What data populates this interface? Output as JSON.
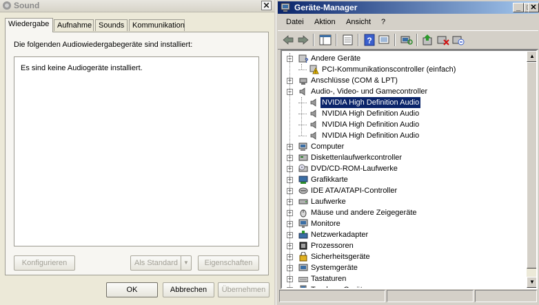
{
  "sound": {
    "title": "Sound",
    "tabs": [
      "Wiedergabe",
      "Aufnahme",
      "Sounds",
      "Kommunikation"
    ],
    "description": "Die folgenden Audiowiedergabegeräte sind installiert:",
    "empty_message": "Es sind keine Audiogeräte installiert.",
    "buttons": {
      "configure": "Konfigurieren",
      "set_default": "Als Standard",
      "properties": "Eigenschaften",
      "ok": "OK",
      "cancel": "Abbrechen",
      "apply": "Übernehmen"
    }
  },
  "devmgr": {
    "title": "Geräte-Manager",
    "menu": [
      "Datei",
      "Aktion",
      "Ansicht",
      "?"
    ],
    "toolbar_icons": [
      "back-arrow-icon",
      "forward-arrow-icon",
      "console-tree-icon",
      "properties-icon",
      "help-icon",
      "show-hidden-icon",
      "scan-hardware-icon",
      "update-driver-icon",
      "uninstall-icon",
      "disable-icon"
    ],
    "tree": [
      {
        "label": "Andere Geräte",
        "level": 1,
        "expander": "minus",
        "icon": "unknown-device-icon"
      },
      {
        "label": "PCI-Kommunikationscontroller (einfach)",
        "level": 2,
        "expander": "",
        "icon": "warning-device-icon"
      },
      {
        "label": "Anschlüsse (COM & LPT)",
        "level": 1,
        "expander": "plus",
        "icon": "port-icon"
      },
      {
        "label": "Audio-, Video- und Gamecontroller",
        "level": 1,
        "expander": "minus",
        "icon": "speaker-icon"
      },
      {
        "label": "NVIDIA High Definition Audio",
        "level": 2,
        "expander": "",
        "icon": "speaker-icon",
        "selected": true
      },
      {
        "label": "NVIDIA High Definition Audio",
        "level": 2,
        "expander": "",
        "icon": "speaker-icon"
      },
      {
        "label": "NVIDIA High Definition Audio",
        "level": 2,
        "expander": "",
        "icon": "speaker-icon"
      },
      {
        "label": "NVIDIA High Definition Audio",
        "level": 2,
        "expander": "",
        "icon": "speaker-icon"
      },
      {
        "label": "Computer",
        "level": 1,
        "expander": "plus",
        "icon": "computer-icon"
      },
      {
        "label": "Diskettenlaufwerkcontroller",
        "level": 1,
        "expander": "plus",
        "icon": "floppy-controller-icon"
      },
      {
        "label": "DVD/CD-ROM-Laufwerke",
        "level": 1,
        "expander": "plus",
        "icon": "dvd-drive-icon"
      },
      {
        "label": "Grafikkarte",
        "level": 1,
        "expander": "plus",
        "icon": "display-adapter-icon"
      },
      {
        "label": "IDE ATA/ATAPI-Controller",
        "level": 1,
        "expander": "plus",
        "icon": "ide-controller-icon"
      },
      {
        "label": "Laufwerke",
        "level": 1,
        "expander": "plus",
        "icon": "disk-drive-icon"
      },
      {
        "label": "Mäuse und andere Zeigegeräte",
        "level": 1,
        "expander": "plus",
        "icon": "mouse-icon"
      },
      {
        "label": "Monitore",
        "level": 1,
        "expander": "plus",
        "icon": "monitor-icon"
      },
      {
        "label": "Netzwerkadapter",
        "level": 1,
        "expander": "plus",
        "icon": "network-adapter-icon"
      },
      {
        "label": "Prozessoren",
        "level": 1,
        "expander": "plus",
        "icon": "processor-icon"
      },
      {
        "label": "Sicherheitsgeräte",
        "level": 1,
        "expander": "plus",
        "icon": "security-device-icon"
      },
      {
        "label": "Systemgeräte",
        "level": 1,
        "expander": "plus",
        "icon": "system-device-icon"
      },
      {
        "label": "Tastaturen",
        "level": 1,
        "expander": "plus",
        "icon": "keyboard-icon"
      },
      {
        "label": "Tragbare Geräte",
        "level": 1,
        "expander": "plus",
        "icon": "portable-device-icon"
      }
    ]
  },
  "colors": {
    "selection": "#0a246a",
    "titlebar_active": "#0a246a",
    "dialog_bg": "#ece9d8"
  }
}
